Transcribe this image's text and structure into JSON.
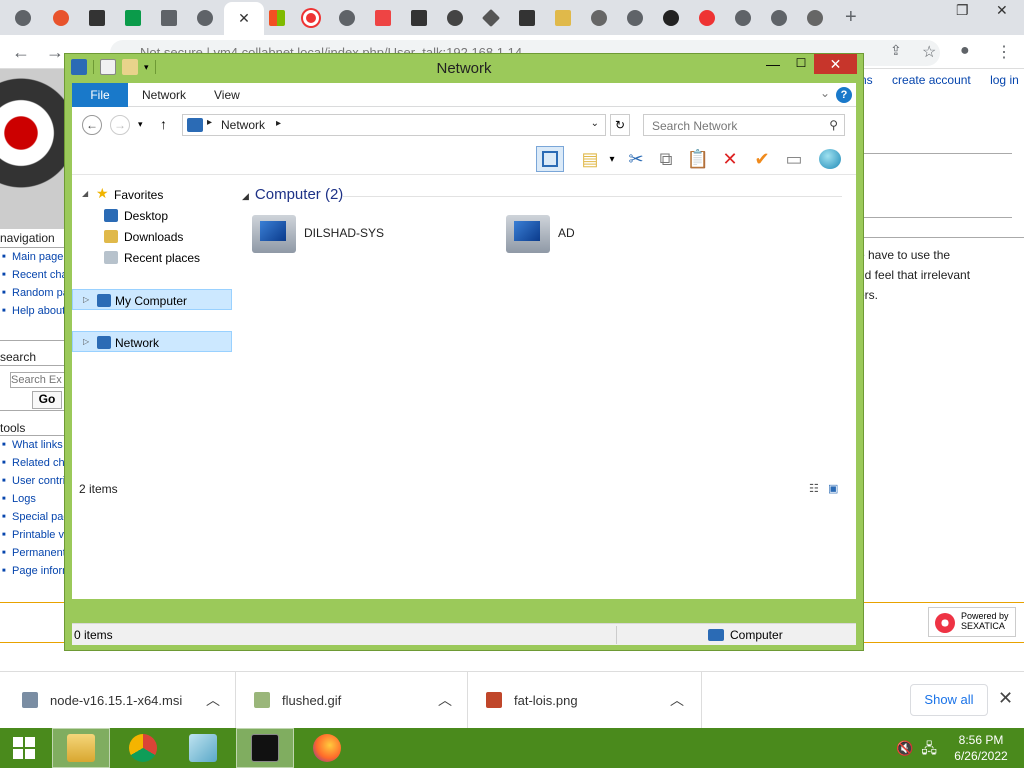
{
  "browser": {
    "url_text": "Not secure | vm4.collabnet.local/index.php/User_talk:192.168.1.14",
    "active_tab_close": "✕",
    "new_tab": "+",
    "window_controls": {
      "minimize": "—",
      "restore": "❐",
      "close": "✕"
    },
    "tab_favicons": [
      "bug-icon",
      "globe-icon",
      "sqlite-icon",
      "nginx-icon",
      "download-icon",
      "globe-icon",
      "close-icon",
      "windows-icon",
      "ring-icon",
      "globe-icon",
      "store-icon",
      "sqlite-icon",
      "chrome-icon",
      "diamond-icon",
      "sqlite-icon",
      "folder-icon",
      "gear-icon",
      "globe-icon",
      "star-wars-icon",
      "ring-icon",
      "globe-icon",
      "globe-icon",
      "gear-icon"
    ]
  },
  "wiki": {
    "top_links": [
      "ns",
      "create account",
      "log in"
    ],
    "navigation": {
      "heading": "navigation",
      "items": [
        "Main page",
        "Recent changes",
        "Random page",
        "Help about MediaWiki"
      ]
    },
    "search": {
      "heading": "search",
      "placeholder": "Search Ex",
      "go": "Go"
    },
    "tools": {
      "heading": "tools",
      "items": [
        "What links here",
        "Related changes",
        "User contributions",
        "Logs",
        "Special pages",
        "Printable version",
        "Permanent link",
        "Page information"
      ]
    },
    "body_lines": [
      "e have to use the",
      "nd feel that irrelevant",
      "ers."
    ],
    "powered_by": {
      "line1": "Powered by",
      "line2": "SEXATICA"
    }
  },
  "explorer": {
    "title": "Network",
    "ribbon_tabs": {
      "file": "File",
      "network": "Network",
      "view": "View"
    },
    "help": "?",
    "address": "Network",
    "search_placeholder": "Search Network",
    "nav_pane": {
      "favorites": "Favorites",
      "desktop": "Desktop",
      "downloads": "Downloads",
      "recent": "Recent places",
      "my_computer": "My Computer",
      "network": "Network"
    },
    "group_header": "Computer (2)",
    "computers": [
      "DILSHAD-SYS",
      "AD"
    ],
    "items_count": "2 items",
    "status_left": "0 items",
    "status_right": "Computer"
  },
  "downloads": {
    "items": [
      "node-v16.15.1-x64.msi",
      "flushed.gif",
      "fat-lois.png"
    ],
    "show_all": "Show all"
  },
  "taskbar": {
    "time": "8:56 PM",
    "date": "6/26/2022",
    "apps": [
      "file-explorer-icon",
      "chrome-icon",
      "notepad-icon",
      "cmd-icon",
      "firefox-icon"
    ]
  }
}
